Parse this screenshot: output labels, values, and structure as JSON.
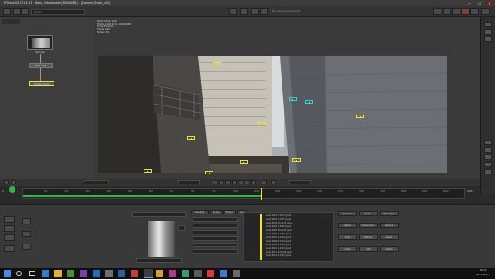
{
  "window": {
    "title": "PFTrack 2017.04.13 - Main, VideoInside [REMAKER] - [Camera_Track_v02]",
    "min_label": "—",
    "max_label": "☐",
    "close_label": "✕"
  },
  "toolbar": {
    "search_placeholder": "Search",
    "message": "No camera solve found"
  },
  "node_panel": {
    "nodes": [
      {
        "label": "Clip Input"
      },
      {
        "label": "Auto Track"
      },
      {
        "label": "Camera Solver"
      }
    ]
  },
  "viewer": {
    "info_lines": [
      "Start: 1  End: 2145",
      "Frame: 1234   Dims: 1920x1080",
      "Focal: 35.0mm",
      "Tracks: 168",
      "Solved: 0%"
    ]
  },
  "timeline": {
    "frame_start": "0",
    "frame_end": "2145",
    "current_frame": "1234",
    "ticks": [
      "100",
      "200",
      "300",
      "400",
      "500",
      "600",
      "700",
      "800",
      "900",
      "1000",
      "1100",
      "1200",
      "1300",
      "1400",
      "1500",
      "1600",
      "1700",
      "1800",
      "1900",
      "2000"
    ],
    "progress": 0.54
  },
  "bottom": {
    "tabs": [
      "Tracking",
      "Solve",
      "Export",
      "Lens"
    ],
    "buttons": [
      "Solve All",
      "Refine",
      "Set Origin",
      "Reset",
      "Solve Cam",
      "Unsolve",
      "Auto",
      "Options",
      "Select",
      "Clear",
      "Add",
      "Delete"
    ],
    "list_rows": [
      "Auto 0001    1-2145    good",
      "Auto 0002    1-1987    good",
      "Auto 0003    12-2145   good",
      "Auto 0004    1-2090    good",
      "Auto 0005    30-2145   good",
      "Auto 0006    1-1880    good",
      "Auto 0007    1-2145    good",
      "Auto 0008    5-2145    good",
      "Auto 0009    1-2010    good",
      "Auto 0010    1-2145    good",
      "Auto 0011    44-2145   good",
      "Auto 0012    1-2145    good"
    ]
  },
  "taskbar": {
    "time": "16:27",
    "date": "02.11.2017"
  },
  "colors": {
    "accent_green": "#2fb84a",
    "track_yellow": "#e8e23a",
    "track_cyan": "#2ad2e0"
  }
}
